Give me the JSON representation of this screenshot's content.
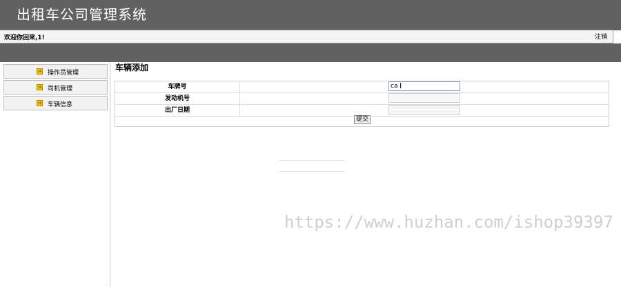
{
  "app": {
    "title": "出租车公司管理系统"
  },
  "welcome_bar": {
    "text": "欢迎你回来,1!",
    "logout_label": "注销"
  },
  "sidebar": {
    "items": [
      {
        "label": "操作员管理",
        "icon": "arrow-right-icon"
      },
      {
        "label": "司机管理",
        "icon": "arrow-right-icon"
      },
      {
        "label": "车辆信息",
        "icon": "arrow-right-icon"
      }
    ]
  },
  "main": {
    "title": "车辆添加",
    "form": {
      "fields": [
        {
          "label": "车牌号",
          "value": "ca"
        },
        {
          "label": "发动机号",
          "value": ""
        },
        {
          "label": "出厂日期",
          "value": ""
        }
      ],
      "submit_label": "提交"
    }
  },
  "watermark": "https://www.huzhan.com/ishop39397",
  "colors": {
    "header_bg": "#616161",
    "title_text": "#ffffff",
    "focus_border": "#7f9db9"
  }
}
